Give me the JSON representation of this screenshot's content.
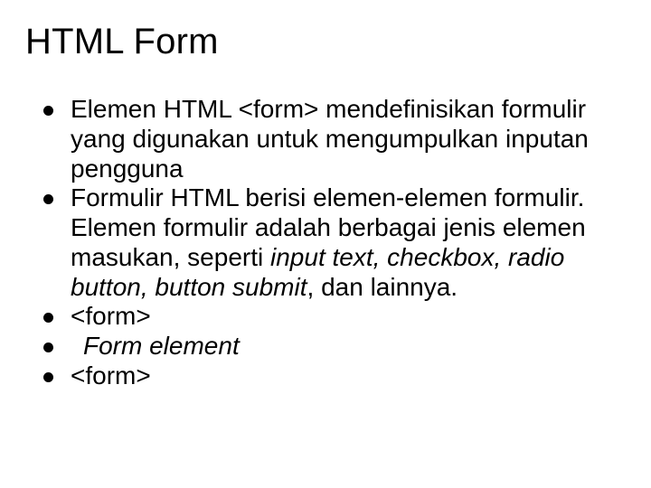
{
  "title": "HTML Form",
  "bullets": {
    "b1_a": "Elemen HTML <form> mendefinisikan formulir yang digunakan untuk mengumpulkan inputan pengguna",
    "b2_a": "Formulir HTML berisi elemen-elemen formulir. Elemen formulir adalah berbagai jenis elemen masukan, seperti ",
    "b2_i": "input text, checkbox, radio button, button submit",
    "b2_b": ", dan lainnya.",
    "b3": "<form>",
    "b4": "Form element",
    "b5": "<form>"
  }
}
